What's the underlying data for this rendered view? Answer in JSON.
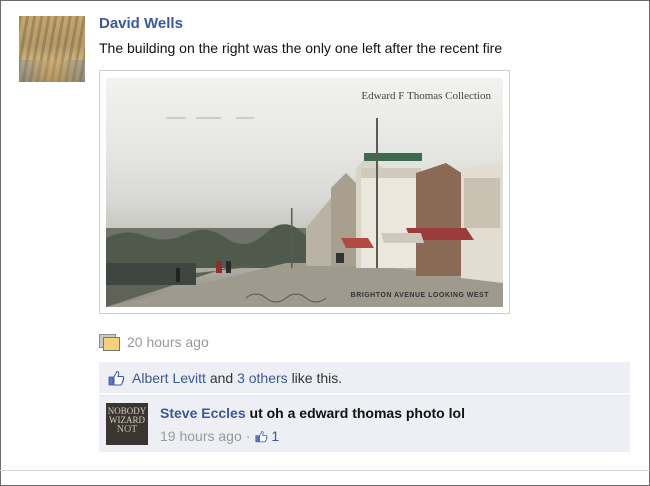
{
  "post": {
    "author": "David Wells",
    "message": "The building on the right was the only one left after the recent fire",
    "photo": {
      "caption": "Edward F Thomas Collection",
      "postcard_title": "BRIGHTON AVENUE LOOKING WEST"
    },
    "timestamp": "20 hours ago"
  },
  "likes": {
    "first_liker": "Albert Levitt",
    "connector": "and",
    "others": "3 others",
    "suffix": "like this."
  },
  "comment": {
    "author": "Steve Eccles",
    "text": "ut oh a edward thomas photo lol",
    "timestamp": "19 hours ago",
    "separator": "·",
    "like_count": "1",
    "avatar_text": [
      "NOBODY",
      "WIZARD",
      "NOT"
    ]
  },
  "colors": {
    "link": "#3b5998",
    "muted": "#999999",
    "ufi_background": "#edeff4"
  },
  "icons": {
    "post_photo": "photo-icon",
    "likes": "thumbs-up-icon",
    "comment_like": "thumbs-up-icon"
  }
}
